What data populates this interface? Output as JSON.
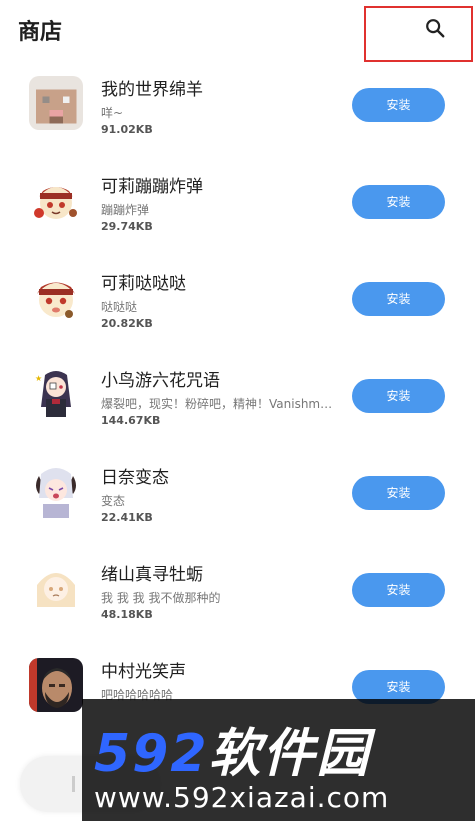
{
  "header": {
    "title": "商店",
    "search_icon": "search-icon"
  },
  "colors": {
    "accent": "#4a98ee",
    "highlight_border": "#e0312f"
  },
  "items": [
    {
      "name": "我的世界绵羊",
      "desc": "咩~",
      "size": "91.02KB",
      "install": "安装",
      "icon": "sheep-avatar"
    },
    {
      "name": "可莉蹦蹦炸弹",
      "desc": "蹦蹦炸弹",
      "size": "29.74KB",
      "install": "安装",
      "icon": "klee-avatar"
    },
    {
      "name": "可莉哒哒哒",
      "desc": "哒哒哒",
      "size": "20.82KB",
      "install": "安装",
      "icon": "klee-avatar"
    },
    {
      "name": "小鸟游六花咒语",
      "desc": "爆裂吧，现实！粉碎吧，精神！Vanishment This World！",
      "size": "144.67KB",
      "install": "安装",
      "icon": "rikka-avatar"
    },
    {
      "name": "日奈变态",
      "desc": "变态",
      "size": "22.41KB",
      "install": "安装",
      "icon": "hina-avatar"
    },
    {
      "name": "绪山真寻牡蛎",
      "desc": "我 我 我 我不做那种的",
      "size": "48.18KB",
      "install": "安装",
      "icon": "mahiro-avatar"
    },
    {
      "name": "中村光笑声",
      "desc": "吧哈哈哈哈哈",
      "size": "",
      "install": "安装",
      "icon": "man-avatar"
    }
  ],
  "watermark": {
    "brand_num": "592",
    "brand_text": "软件园",
    "url": "www.592xiazai.com"
  }
}
